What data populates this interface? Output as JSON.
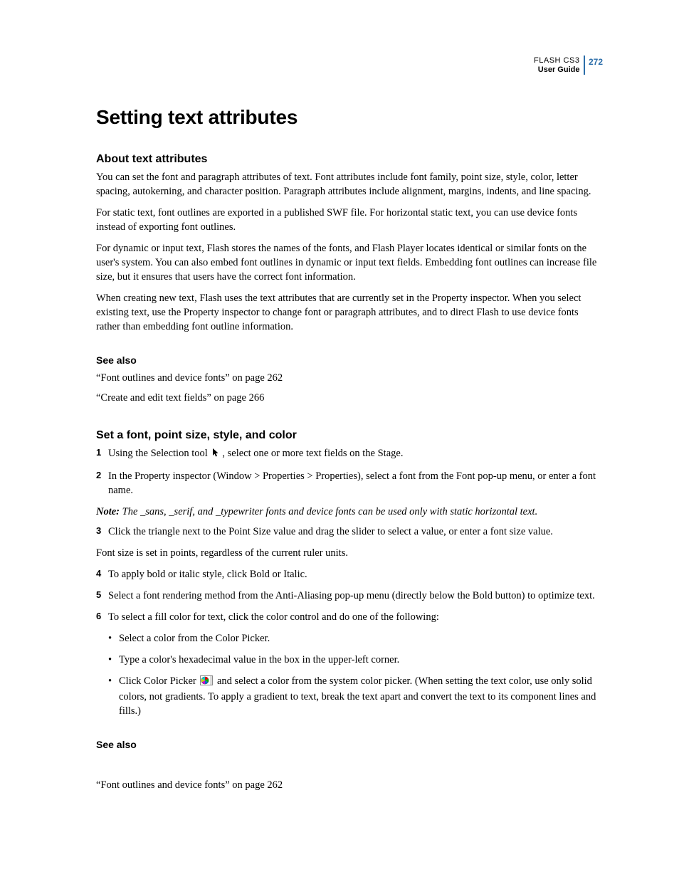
{
  "header": {
    "product": "FLASH CS3",
    "guide": "User Guide",
    "page_number": "272"
  },
  "title": "Setting text attributes",
  "section_about": {
    "heading": "About text attributes",
    "p1": "You can set the font and paragraph attributes of text. Font attributes include font family, point size, style, color, letter spacing, autokerning, and character position. Paragraph attributes include alignment, margins, indents, and line spacing.",
    "p2": "For static text, font outlines are exported in a published SWF file. For horizontal static text, you can use device fonts instead of exporting font outlines.",
    "p3": "For dynamic or input text, Flash stores the names of the fonts, and Flash Player locates identical or similar fonts on the user's system. You can also embed font outlines in dynamic or input text fields. Embedding font outlines can increase file size, but it ensures that users have the correct font information.",
    "p4": "When creating new text, Flash uses the text attributes that are currently set in the Property inspector. When you select existing text, use the Property inspector to change font or paragraph attributes, and to direct Flash to use device fonts rather than embedding font outline information."
  },
  "see_also_1": {
    "heading": "See also",
    "link1": "“Font outlines and device fonts” on page 262",
    "link2": "“Create and edit text fields” on page 266"
  },
  "section_set": {
    "heading": "Set a font, point size, style, and color",
    "step1a": "Using the Selection tool ",
    "step1b": ", select one or more text fields on the Stage.",
    "step2": "In the Property inspector (Window > Properties > Properties), select a font from the Font pop-up menu, or enter a font name.",
    "note_label": "Note:",
    "note_body": " The _sans, _serif, and _typewriter fonts and device fonts can be used only with static horizontal text.",
    "step3": "Click the triangle next to the Point Size value and drag the slider to select a value, or enter a font size value.",
    "after_step3": "Font size is set in points, regardless of the current ruler units.",
    "step4": "To apply bold or italic style, click Bold or Italic.",
    "step5": "Select a font rendering method from the Anti-Aliasing pop-up menu (directly below the Bold button) to optimize text.",
    "step6": "To select a fill color for text, click the color control and do one of the following:",
    "bullet1": "Select a color from the Color Picker.",
    "bullet2": "Type a color's hexadecimal value in the box in the upper-left corner.",
    "bullet3a": "Click Color Picker ",
    "bullet3b": " and select a color from the system color picker. (When setting the text color, use only solid colors, not gradients. To apply a gradient to text, break the text apart and convert the text to its component lines and fills.)"
  },
  "see_also_2": {
    "heading": "See also",
    "link1": "“Font outlines and device fonts” on page 262"
  },
  "icons": {
    "selection_tool": "selection-tool-icon",
    "color_picker": "color-picker-icon"
  }
}
